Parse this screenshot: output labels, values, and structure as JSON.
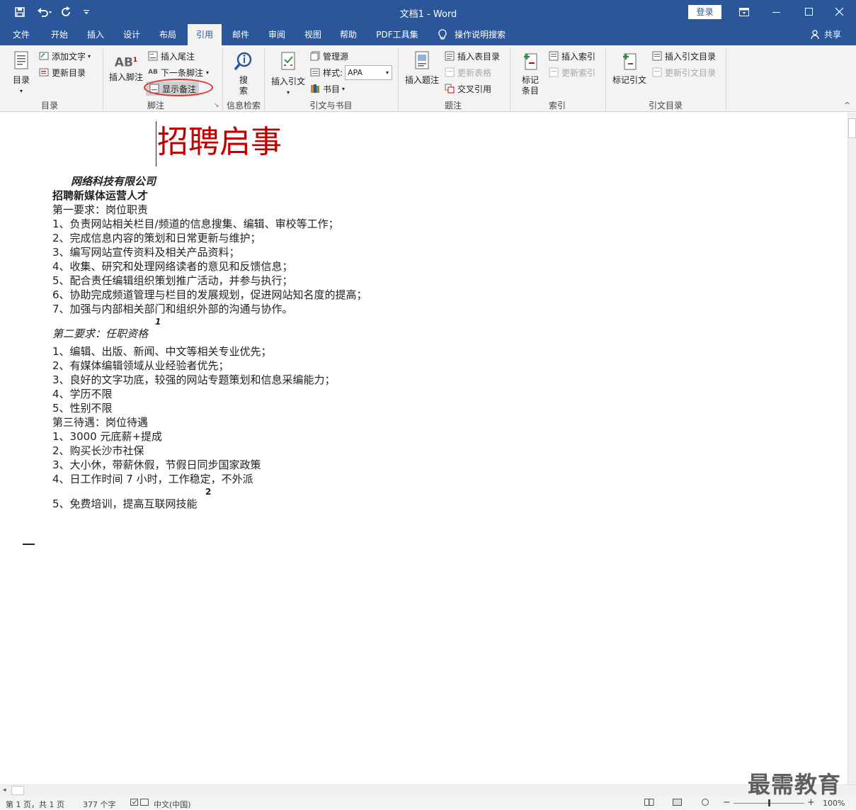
{
  "app": {
    "title": "文档1  -  Word",
    "login_label": "登录"
  },
  "tabs": [
    "文件",
    "开始",
    "插入",
    "设计",
    "布局",
    "引用",
    "邮件",
    "审阅",
    "视图",
    "帮助",
    "PDF工具集"
  ],
  "tell_me": "操作说明搜索",
  "share": "共享",
  "ribbon": {
    "toc": {
      "big": "目录",
      "add_text": "添加文字",
      "update_toc": "更新目录",
      "group": "目录"
    },
    "footnotes": {
      "insert_footnote": "插入脚注",
      "insert_endnote": "插入尾注",
      "next_footnote": "下一条脚注",
      "show_notes": "显示备注",
      "group": "脚注"
    },
    "research": {
      "search_line1": "搜",
      "search_line2": "索",
      "group": "信息检索"
    },
    "citations": {
      "insert_citation": "插入引文",
      "manage_sources": "管理源",
      "style_label": "样式:",
      "style_value": "APA",
      "bibliography": "书目",
      "group": "引文与书目"
    },
    "captions": {
      "insert_caption": "插入题注",
      "insert_table_of_figures": "插入表目录",
      "update_table": "更新表格",
      "cross_reference": "交叉引用",
      "group": "题注"
    },
    "index": {
      "mark_entry_l1": "标记",
      "mark_entry_l2": "条目",
      "insert_index": "插入索引",
      "update_index": "更新索引",
      "group": "索引"
    },
    "toa": {
      "mark_citation": "标记引文",
      "insert_toa": "插入引文目录",
      "update_toa": "更新引文目录",
      "group": "引文目录"
    }
  },
  "document": {
    "title": "招聘启事",
    "company": "网络科技有限公司",
    "headline": "招聘新媒体运营人才",
    "section1": "第一要求：岗位职责",
    "duties": [
      "1、负责网站相关栏目/频道的信息搜集、编辑、审校等工作；",
      "2、完成信息内容的策划和日常更新与维护；",
      "3、编写网站宣传资料及相关产品资料；",
      "4、收集、研究和处理网络读者的意见和反馈信息；",
      "5、配合责任编辑组织策划推广活动，并参与执行；",
      "6、协助完成频道管理与栏目的发展规划，促进网站知名度的提高；",
      "7、加强与内部相关部门和组织外部的沟通与协作。"
    ],
    "footnote_mark_1": "1",
    "section2": "第二要求：任职资格",
    "qualifications": [
      "1、编辑、出版、新闻、中文等相关专业优先；",
      "2、有媒体编辑领域从业经验者优先；",
      "3、良好的文字功底，较强的网站专题策划和信息采编能力；",
      "4、学历不限",
      "5、性别不限"
    ],
    "section3": "第三待遇：岗位待遇",
    "benefits": [
      "1、3000 元底薪+提成",
      "2、购买长沙市社保",
      "3、大小休，带薪休假，节假日同步国家政策",
      "4、日工作时间 7 小时，工作稳定，不外派"
    ],
    "footnote_mark_2": "2",
    "benefit_last": "5、免费培训，提高互联网技能"
  },
  "watermark": "最需教育",
  "status": {
    "page": "第 1 页，共 1 页",
    "words": "377 个字",
    "lang": "中文(中国)",
    "zoom": "100%",
    "zoom_level": 0.5
  },
  "colors": {
    "brand": "#2b579a",
    "title_red": "#c00000",
    "highlight_circle": "#e03030"
  }
}
